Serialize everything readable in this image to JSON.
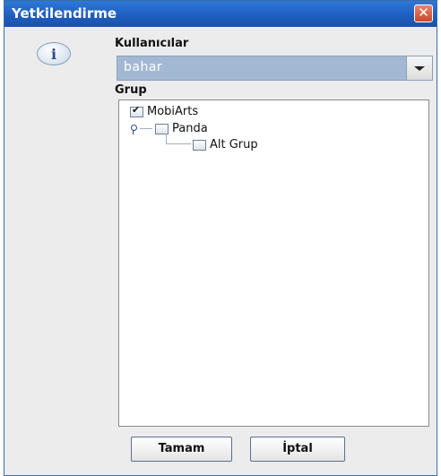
{
  "window": {
    "title": "Yetkilendirme",
    "close_symbol": "✕"
  },
  "info_icon": {
    "symbol": "i"
  },
  "users": {
    "label": "Kullanıcılar",
    "selected": "bahar"
  },
  "group": {
    "label": "Grup",
    "tree": [
      {
        "label": "MobiArts",
        "checked": true
      },
      {
        "label": "Panda",
        "checked": false
      },
      {
        "label": "Alt Grup",
        "checked": false
      }
    ]
  },
  "buttons": {
    "ok": "Tamam",
    "cancel": "İptal"
  },
  "colors": {
    "titlebar": "#1e5fc2",
    "combo_selected": "#a3b8d3",
    "dialog_bg": "#ececec"
  }
}
